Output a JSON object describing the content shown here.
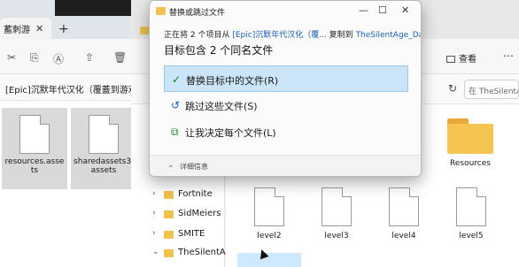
{
  "left_window": {
    "tab_title": "蓄刺游",
    "address_text": "[Epic]沉默年代汉化（覆蓋到游戏目录...",
    "files": [
      {
        "name": "resources.assets"
      },
      {
        "name": "sharedassets3.assets"
      }
    ]
  },
  "right_window": {
    "view_label": "查看",
    "search_placeholder": "在 TheSilentA",
    "nav_items": [
      {
        "label": "Fortnite"
      },
      {
        "label": "SidMeiers"
      },
      {
        "label": "SMITE"
      },
      {
        "label": "TheSilentA"
      }
    ],
    "folder": {
      "name": "Resources"
    },
    "files": [
      {
        "name": "level2"
      },
      {
        "name": "level3"
      },
      {
        "name": "level4"
      },
      {
        "name": "level5"
      }
    ]
  },
  "dialog": {
    "title": "替换或跳过文件",
    "subtitle_prefix": "正在将 2 个项目从",
    "subtitle_source": "[Epic]沉默年代汉化（覆...",
    "subtitle_mid": "复制到",
    "subtitle_dest": "TheSilentAge_Data",
    "heading": "目标包含 2 个同名文件",
    "options": [
      {
        "icon": "check-icon",
        "label": "替换目标中的文件(R)",
        "selected": true
      },
      {
        "icon": "skip-icon",
        "label": "跳过这些文件(S)",
        "selected": false
      },
      {
        "icon": "choose-icon",
        "label": "让我决定每个文件(L)",
        "selected": false
      }
    ],
    "details_label": "详细信息"
  },
  "colors": {
    "accent": "#0067c0",
    "selection": "#cce4f7",
    "folder": "#f5c451"
  }
}
